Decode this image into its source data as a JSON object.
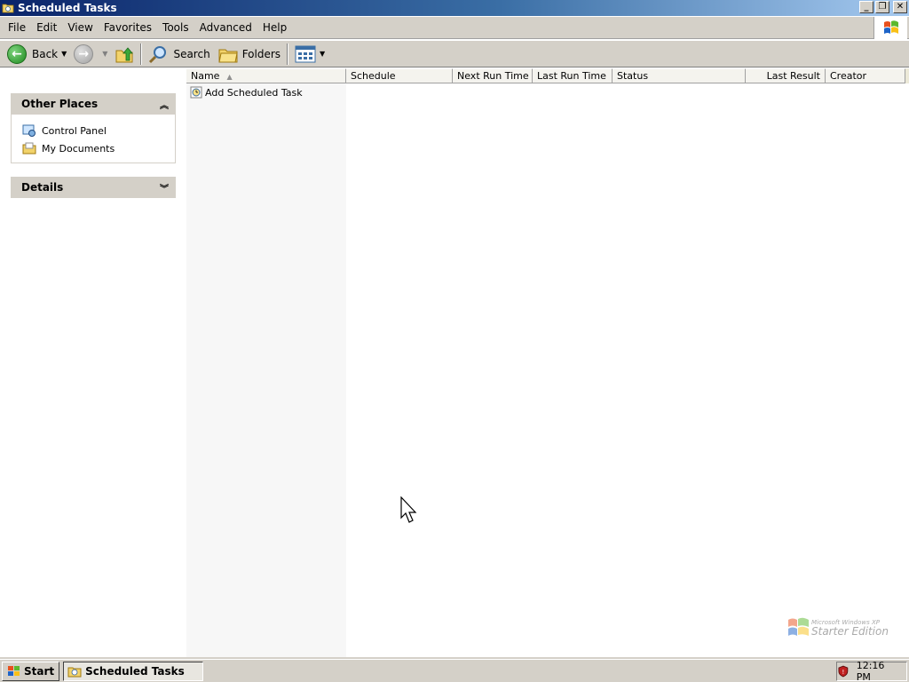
{
  "window": {
    "title": "Scheduled Tasks"
  },
  "menu": [
    "File",
    "Edit",
    "View",
    "Favorites",
    "Tools",
    "Advanced",
    "Help"
  ],
  "toolbar": {
    "back_label": "Back",
    "search_label": "Search",
    "folders_label": "Folders"
  },
  "taskpane": {
    "other_places_title": "Other Places",
    "links": [
      "Control Panel",
      "My Documents"
    ],
    "details_title": "Details"
  },
  "columns": [
    "Name",
    "Schedule",
    "Next Run Time",
    "Last Run Time",
    "Status",
    "Last Result",
    "Creator"
  ],
  "items": [
    {
      "name": "Add Scheduled Task"
    }
  ],
  "watermark": {
    "line1": "Microsoft Windows XP",
    "line2": "Starter Edition"
  },
  "taskbar": {
    "start_label": "Start",
    "task_label": "Scheduled Tasks",
    "clock": "12:16 PM"
  },
  "colors": {
    "titlebar_start": "#0a246a",
    "titlebar_end": "#a6caf0",
    "face": "#d4d0c8"
  }
}
